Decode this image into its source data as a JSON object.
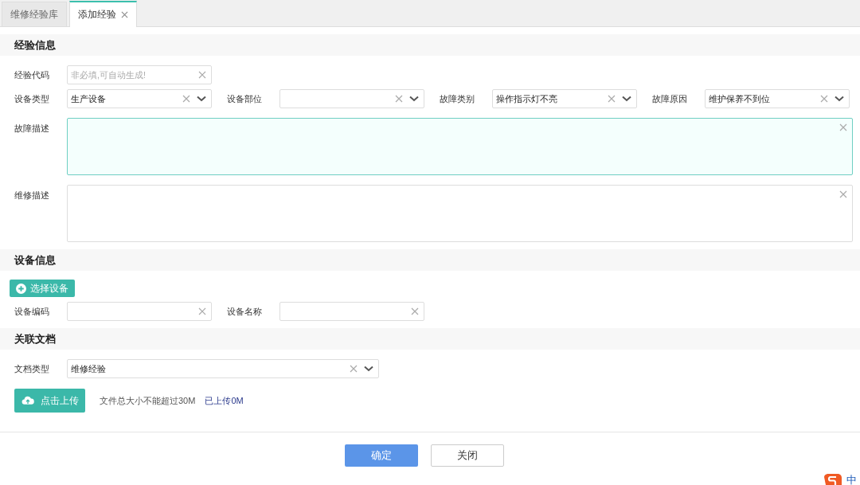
{
  "tabs": [
    {
      "label": "维修经验库",
      "selected": false,
      "closable": false
    },
    {
      "label": "添加经验",
      "selected": true,
      "closable": true
    }
  ],
  "sections": [
    {
      "title": "经验信息",
      "items": [
        {
          "kind": "fields",
          "fields": [
            {
              "kind": "input",
              "label": "经验代码",
              "placeholder": "非必填,可自动生成!"
            }
          ]
        },
        {
          "kind": "fields",
          "fields": [
            {
              "kind": "select",
              "label": "设备类型",
              "value": "生产设备"
            },
            {
              "kind": "select",
              "label": "设备部位"
            },
            {
              "kind": "select",
              "label": "故障类别",
              "value": "操作指示灯不亮"
            },
            {
              "kind": "select",
              "label": "故障原因",
              "value": "维护保养不到位"
            }
          ]
        },
        {
          "kind": "textarea",
          "label": "故障描述",
          "focused": true
        },
        {
          "kind": "textarea",
          "label": "维修描述",
          "focused": false
        }
      ]
    },
    {
      "title": "设备信息",
      "items": [
        {
          "kind": "action_button",
          "label": "选择设备"
        },
        {
          "kind": "fields",
          "fields": [
            {
              "kind": "input",
              "label": "设备编码"
            },
            {
              "kind": "input",
              "label": "设备名称"
            }
          ]
        }
      ]
    },
    {
      "title": "关联文档",
      "items": [
        {
          "kind": "fields",
          "fields": [
            {
              "kind": "wide_select",
              "label": "文档类型",
              "value": "维修经验"
            }
          ]
        },
        {
          "kind": "upload",
          "label": "点击上传",
          "note": "文件总大小不能超过30M",
          "status": "已上传0M"
        }
      ]
    }
  ],
  "footer": {
    "buttons": [
      {
        "label": "确定",
        "kind": "primary"
      },
      {
        "label": "关闭",
        "kind": "default"
      }
    ]
  },
  "ime": {
    "label": "中"
  }
}
